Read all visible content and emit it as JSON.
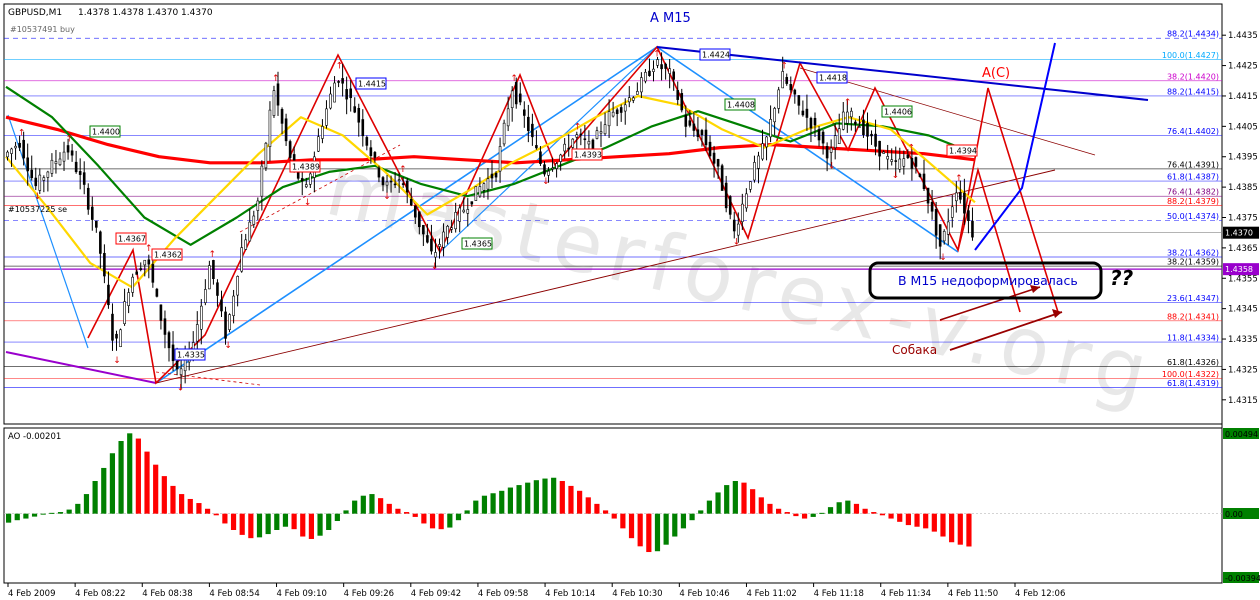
{
  "header": {
    "symbol": "GBPUSD,M1",
    "ohlc": "1.4378 1.4378 1.4370 1.4370",
    "order_buy": "#10537491 buy",
    "order_sell": "#10537225 se"
  },
  "annotations": {
    "wave_title": "A M15",
    "wave_label": "A(C)",
    "box_text": "В М15 недоформировалась",
    "question": "??",
    "dog_label": "Собака"
  },
  "chart_data": [
    {
      "type": "candlestick",
      "symbol": "GBPUSD",
      "timeframe": "M1",
      "ylim": [
        1.431,
        1.444
      ],
      "y_ticks": [
        "1.4435",
        "1.4425",
        "1.4415",
        "1.4405",
        "1.4395",
        "1.4385",
        "1.4375",
        "1.4365",
        "1.4355",
        "1.4345",
        "1.4335",
        "1.4325",
        "1.4315"
      ],
      "x_ticks": [
        "4 Feb 2009",
        "4 Feb 08:22",
        "4 Feb 08:38",
        "4 Feb 08:54",
        "4 Feb 09:10",
        "4 Feb 09:26",
        "4 Feb 09:42",
        "4 Feb 09:58",
        "4 Feb 10:14",
        "4 Feb 10:30",
        "4 Feb 10:46",
        "4 Feb 11:02",
        "4 Feb 11:18",
        "4 Feb 11:34",
        "4 Feb 11:50",
        "4 Feb 12:06"
      ],
      "price_path": [
        [
          0,
          1.4395
        ],
        [
          1,
          1.44
        ],
        [
          2,
          1.4385
        ],
        [
          3,
          1.4392
        ],
        [
          4,
          1.4398
        ],
        [
          5,
          1.4386
        ],
        [
          6,
          1.4367
        ],
        [
          7,
          1.4331
        ],
        [
          8,
          1.4355
        ],
        [
          9,
          1.4362
        ],
        [
          10,
          1.434
        ],
        [
          11,
          1.4322
        ],
        [
          12,
          1.4335
        ],
        [
          13,
          1.436
        ],
        [
          14,
          1.4336
        ],
        [
          15,
          1.4365
        ],
        [
          16,
          1.438
        ],
        [
          17,
          1.4418
        ],
        [
          18,
          1.4395
        ],
        [
          19,
          1.4383
        ],
        [
          20,
          1.4405
        ],
        [
          21,
          1.4422
        ],
        [
          22,
          1.4412
        ],
        [
          23,
          1.4398
        ],
        [
          24,
          1.4385
        ],
        [
          25,
          1.4388
        ],
        [
          26,
          1.4375
        ],
        [
          27,
          1.4362
        ],
        [
          28,
          1.4372
        ],
        [
          29,
          1.4378
        ],
        [
          30,
          1.4385
        ],
        [
          31,
          1.439
        ],
        [
          32,
          1.4418
        ],
        [
          33,
          1.4405
        ],
        [
          34,
          1.439
        ],
        [
          35,
          1.4395
        ],
        [
          36,
          1.4402
        ],
        [
          37,
          1.4398
        ],
        [
          38,
          1.4408
        ],
        [
          39,
          1.4412
        ],
        [
          40,
          1.4418
        ],
        [
          41,
          1.4426
        ],
        [
          42,
          1.4422
        ],
        [
          43,
          1.4405
        ],
        [
          44,
          1.4402
        ],
        [
          45,
          1.439
        ],
        [
          46,
          1.437
        ],
        [
          47,
          1.4388
        ],
        [
          48,
          1.44
        ],
        [
          49,
          1.4422
        ],
        [
          50,
          1.4412
        ],
        [
          51,
          1.4405
        ],
        [
          52,
          1.4395
        ],
        [
          53,
          1.441
        ],
        [
          54,
          1.4405
        ],
        [
          55,
          1.4398
        ],
        [
          56,
          1.4392
        ],
        [
          57,
          1.4395
        ],
        [
          58,
          1.4385
        ],
        [
          59,
          1.4365
        ],
        [
          60,
          1.4385
        ],
        [
          61,
          1.437
        ]
      ],
      "moving_averages": [
        {
          "color": "#ff0000",
          "values": [
            1.4408,
            1.4404,
            1.4399,
            1.4395,
            1.4393,
            1.4393,
            1.4394,
            1.4394,
            1.4395,
            1.4394,
            1.4393,
            1.4394,
            1.4395,
            1.4396,
            1.4398,
            1.4399,
            1.4398,
            1.4397,
            1.4396,
            1.4394
          ]
        },
        {
          "color": "#008000",
          "values": [
            1.4418,
            1.4408,
            1.4392,
            1.4375,
            1.4366,
            1.4375,
            1.4385,
            1.439,
            1.4392,
            1.4386,
            1.4382,
            1.4386,
            1.4392,
            1.4398,
            1.4405,
            1.441,
            1.4405,
            1.44,
            1.4406,
            1.4405,
            1.4402,
            1.4396
          ]
        },
        {
          "color": "#ffd700",
          "values": [
            1.4395,
            1.4378,
            1.436,
            1.4352,
            1.4368,
            1.4382,
            1.4396,
            1.4408,
            1.4402,
            1.439,
            1.4376,
            1.4384,
            1.4393,
            1.44,
            1.4408,
            1.4415,
            1.4412,
            1.4404,
            1.4398,
            1.4404,
            1.4408,
            1.4404,
            1.4392,
            1.438
          ]
        }
      ],
      "price_boxes": [
        {
          "label": "1.4400",
          "color": "#008000"
        },
        {
          "label": "1.4367",
          "color": "#ff0000"
        },
        {
          "label": "1.4362",
          "color": "#ff0000"
        },
        {
          "label": "1.4335",
          "color": "#0000ff"
        },
        {
          "label": "1.4389",
          "color": "#ff0000"
        },
        {
          "label": "1.4415",
          "color": "#0000ff"
        },
        {
          "label": "1.4365",
          "color": "#008000"
        },
        {
          "label": "1.4393",
          "color": "#ff0000"
        },
        {
          "label": "1.4424",
          "color": "#0000ff"
        },
        {
          "label": "1.4408",
          "color": "#008000"
        },
        {
          "label": "1.4418",
          "color": "#0000ff"
        },
        {
          "label": "1.4406",
          "color": "#008000"
        },
        {
          "label": "1.4394",
          "color": "#ff0000"
        }
      ],
      "levels": [
        {
          "label": "88.2(1.4434)",
          "value": 1.4434,
          "color": "#0000ff"
        },
        {
          "label": "100.0(1.4427)",
          "value": 1.4427,
          "color": "#00aaff"
        },
        {
          "label": "38.2(1.4420)",
          "value": 1.442,
          "color": "#cc00cc"
        },
        {
          "label": "88.2(1.4415)",
          "value": 1.4415,
          "color": "#0000ff"
        },
        {
          "label": "76.4(1.4402)",
          "value": 1.4402,
          "color": "#0000ff"
        },
        {
          "label": "76.4(1.4391)",
          "value": 1.4391,
          "color": "#000000"
        },
        {
          "label": "61.8(1.4387)",
          "value": 1.4387,
          "color": "#0000ff"
        },
        {
          "label": "76.4(1.4382)",
          "value": 1.4382,
          "color": "#800080"
        },
        {
          "label": "88.2(1.4379)",
          "value": 1.4379,
          "color": "#ff0000"
        },
        {
          "label": "50.0(1.4374)",
          "value": 1.4374,
          "color": "#0000ff"
        },
        {
          "label": "38.2(1.4362)",
          "value": 1.4362,
          "color": "#0000ff"
        },
        {
          "label": "38.2(1.4359)",
          "value": 1.4359,
          "color": "#000000"
        },
        {
          "label": "23.6(1.4347)",
          "value": 1.4347,
          "color": "#0000ff"
        },
        {
          "label": "88.2(1.4341)",
          "value": 1.4341,
          "color": "#ff0000"
        },
        {
          "label": "11.8(1.4334)",
          "value": 1.4334,
          "color": "#0000ff"
        },
        {
          "label": "61.8(1.4326)",
          "value": 1.4326,
          "color": "#000000"
        },
        {
          "label": "100.0(1.4322)",
          "value": 1.4322,
          "color": "#ff0000"
        },
        {
          "label": "61.8(1.4319)",
          "value": 1.4319,
          "color": "#0000ff"
        }
      ],
      "current_price": {
        "label": "1.4370",
        "value": 1.437
      },
      "horizontal_line": {
        "label": "1.4358",
        "value": 1.4358,
        "color": "#9900cc"
      }
    },
    {
      "type": "bar",
      "title": "AO -0.00201",
      "ylim": [
        -0.00394,
        0.00494
      ],
      "y_ticks": [
        "0.00494",
        "0.00",
        "-0.00394"
      ],
      "up_color": "#008000",
      "down_color": "#ff0000",
      "values": [
        -0.00055,
        -0.0004,
        -0.0003,
        -0.00018,
        -2e-05,
        5e-05,
        0.0001,
        0.00025,
        0.0006,
        0.0012,
        0.002,
        0.0028,
        0.0037,
        0.00445,
        0.00492,
        0.0046,
        0.0038,
        0.003,
        0.0023,
        0.0017,
        0.0012,
        0.0009,
        0.00065,
        0.0003,
        -0.0001,
        -0.0006,
        -0.001,
        -0.0013,
        -0.0015,
        -0.00145,
        -0.00125,
        -0.001,
        -0.0008,
        -0.00095,
        -0.0014,
        -0.00155,
        -0.00135,
        -0.001,
        -0.00045,
        0.0002,
        0.0008,
        0.0011,
        0.0012,
        0.00095,
        0.0006,
        0.0003,
        0.0001,
        -0.0002,
        -0.0006,
        -0.0009,
        -0.00095,
        -0.00085,
        -0.0004,
        0.0002,
        0.0008,
        0.0011,
        0.00125,
        0.0014,
        0.0016,
        0.00175,
        0.0019,
        0.00205,
        0.00215,
        0.0022,
        0.002,
        0.0017,
        0.0014,
        0.001,
        0.0006,
        0.0002,
        -0.0003,
        -0.0009,
        -0.0015,
        -0.002,
        -0.00235,
        -0.0023,
        -0.0019,
        -0.0014,
        -0.0009,
        -0.0004,
        0.0002,
        0.0008,
        0.0013,
        0.00175,
        0.002,
        0.0019,
        0.0015,
        0.001,
        0.0006,
        0.0003,
        0.0001,
        -0.00015,
        -0.0003,
        -0.0002,
        5e-05,
        0.0004,
        0.0007,
        0.0008,
        0.0006,
        0.0003,
        0.0001,
        -0.0001,
        -0.0003,
        -0.0005,
        -0.0007,
        -0.0008,
        -0.0009,
        -0.0011,
        -0.0014,
        -0.00175,
        -0.0019,
        -0.00201
      ]
    }
  ]
}
